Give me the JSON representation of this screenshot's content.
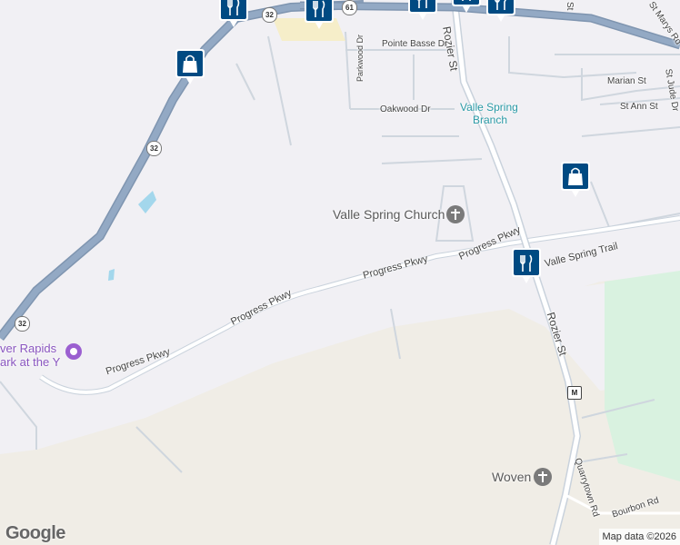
{
  "map": {
    "colors": {
      "land": "#f0ede6",
      "developed": "#f1f0f4",
      "park": "#d9f2e0",
      "water": "#a3d7ec",
      "highway": "#8ea4bf",
      "road": "#ffffff",
      "minor_road": "#cfd6de",
      "marker_fill": "#004a82"
    },
    "road_labels": {
      "progress_1": "Progress Pkwy",
      "progress_2": "Progress Pkwy",
      "progress_3": "Progress Pkwy",
      "progress_4": "Progress Pkwy",
      "valle_spring_trail": "Valle Spring Trail",
      "rozier_top": "Rozier St",
      "rozier_bottom": "Rozier St",
      "pointe_basse": "Pointe Basse Dr",
      "oakwood": "Oakwood Dr",
      "parkwood": "Parkwood Dr",
      "marian": "Marian St",
      "st_ann": "St Ann St",
      "st_jude": "St Jude Dr",
      "st_marys": "St Marys Rd",
      "st_top": "St",
      "quarrytown": "Quarrytown Rd",
      "bourbon": "Bourbon Rd"
    },
    "route_shields": {
      "r32_top": "32",
      "r32_mid": "32",
      "r32_low": "32",
      "r61": "61",
      "rM": "M"
    },
    "places": {
      "church": "Valle Spring Church",
      "woven": "Woven",
      "library_line1": "Valle Spring",
      "library_line2": "Branch",
      "park_line1": "ver Rapids",
      "park_line2": "ark at the Y"
    },
    "markers": [
      {
        "name": "restaurant-marker-1",
        "icon": "fork-knife-icon"
      },
      {
        "name": "restaurant-marker-2",
        "icon": "fork-knife-icon"
      },
      {
        "name": "restaurant-marker-3",
        "icon": "fork-knife-icon"
      },
      {
        "name": "restaurant-marker-4",
        "icon": "fork-knife-icon"
      },
      {
        "name": "restaurant-marker-5",
        "icon": "fork-knife-icon"
      },
      {
        "name": "restaurant-marker-6",
        "icon": "fork-knife-icon"
      },
      {
        "name": "shopping-marker-1",
        "icon": "shopping-bag-icon"
      },
      {
        "name": "shopping-marker-2",
        "icon": "shopping-bag-icon"
      }
    ],
    "logo": "Google",
    "attribution": "Map data ©2026"
  }
}
